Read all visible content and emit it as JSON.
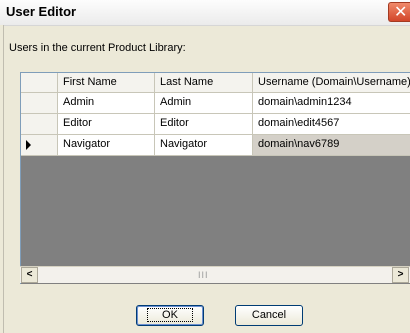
{
  "window": {
    "title": "User Editor",
    "close_glyph": "✕"
  },
  "subtitle": "Users in the current Product Library:",
  "grid": {
    "columns": [
      "",
      "First Name",
      "Last Name",
      "Username (Domain\\Username)"
    ],
    "sort_column": "First Name",
    "rows": [
      {
        "first": "Admin",
        "last": "Admin",
        "username": "domain\\admin1234",
        "current": false,
        "selected": false
      },
      {
        "first": "Editor",
        "last": "Editor",
        "username": "domain\\edit4567",
        "current": false,
        "selected": false
      },
      {
        "first": "Navigator",
        "last": "Navigator",
        "username": "domain\\nav6789",
        "current": true,
        "selected": true
      }
    ]
  },
  "scrollbar": {
    "left_arrow": "<",
    "right_arrow": ">",
    "grip": "III"
  },
  "buttons": {
    "ok": "OK",
    "cancel": "Cancel"
  },
  "colors": {
    "grid_bg": "#808080",
    "selected_cell": "#d4d0c8",
    "close_button": "#d2462a"
  }
}
